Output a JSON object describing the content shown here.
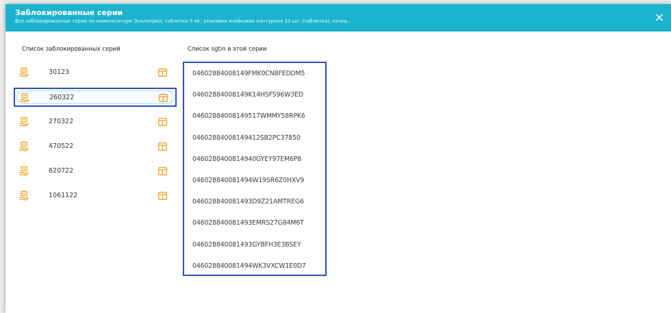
{
  "header": {
    "title": "Заблокированные серии",
    "subtitle": "Все заблокированные серии по номенклатуре Эналаприл, таблетки 5 мг, упаковка ячейковая контурная 10 шт. (таблетка), пачка...",
    "close_icon": "×"
  },
  "colors": {
    "header_bg": "#1bb3cd",
    "highlight_border": "#2f4bbd",
    "icon_orange": "#f0a325"
  },
  "series_panel": {
    "heading": "Список заблокированных серий",
    "items": [
      {
        "label": "30123",
        "selected": false
      },
      {
        "label": "260322",
        "selected": true
      },
      {
        "label": "270322",
        "selected": false
      },
      {
        "label": "470522",
        "selected": false
      },
      {
        "label": "620722",
        "selected": false
      },
      {
        "label": "1061122",
        "selected": false
      }
    ]
  },
  "sgtin_panel": {
    "heading": "Список sgtin в этой серии",
    "items": [
      "04602884008149FMK0CN8FEDDM5",
      "04602884008149K14HSFS96W3ED",
      "04602884008149517WMMY58RPK6",
      "04602884008149412SB2PC37850",
      "0460288400814940GYEY97EM6P8",
      "046028840081494W19SR6Z0HXV9",
      "046028840081493D9Z21AMTREG6",
      "046028840081493EMRS27G84M6T",
      "046028840081493GYBFH3E3BSEY",
      "046028840081494WK3VXCW1E0D7"
    ]
  }
}
